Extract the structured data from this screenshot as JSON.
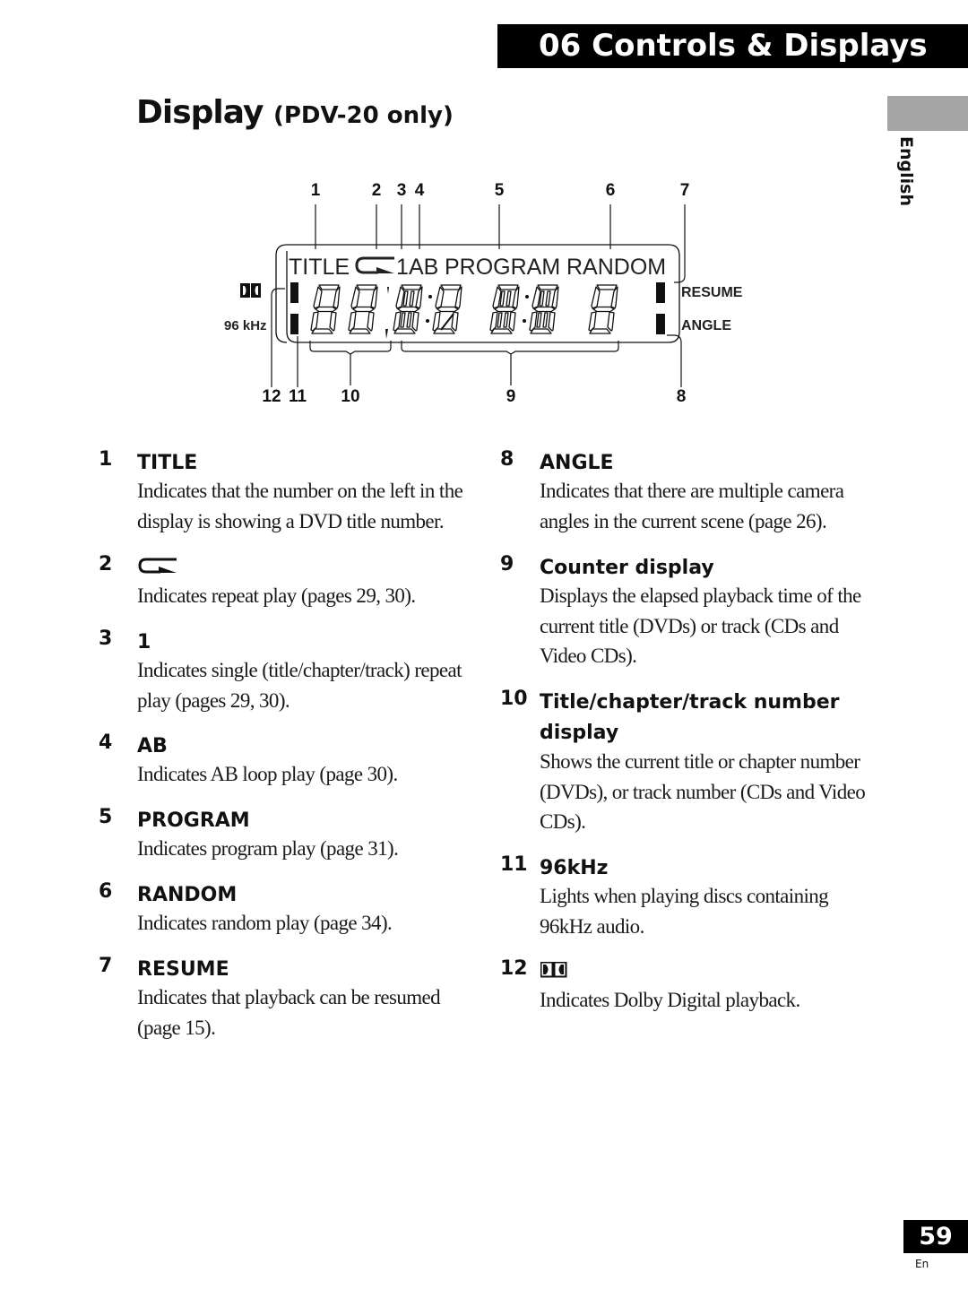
{
  "header": {
    "section_title": "06 Controls & Displays",
    "language_tab": "English"
  },
  "page": {
    "heading": "Display",
    "heading_sub": "(PDV-20 only)",
    "page_number": "59",
    "page_lang": "En"
  },
  "diagram": {
    "callouts_top": [
      "1",
      "2",
      "3",
      "4",
      "5",
      "6",
      "7"
    ],
    "callouts_bottom": [
      "12",
      "11",
      "10",
      "9",
      "8"
    ],
    "lcd": {
      "indicator_title": "TITLE",
      "indicator_one": "1",
      "indicator_ab": "AB",
      "indicator_program": "PROGRAM",
      "indicator_random": "RANDOM",
      "label_resume": "RESUME",
      "label_angle": "ANGLE",
      "label_96khz": "96 kHz",
      "repeat_icon": "repeat-arrow-icon",
      "dolby_icon": "dolby-digital-icon",
      "title_digits": "88",
      "counter_digits": "8:88:88"
    }
  },
  "items_left": [
    {
      "num": "1",
      "head": "TITLE",
      "icon": null,
      "body": [
        "Indicates that the number on the left in the",
        "display is showing a DVD title number."
      ]
    },
    {
      "num": "2",
      "head": "",
      "icon": "repeat-arrow-icon",
      "body": [
        "Indicates repeat play (pages 29, 30)."
      ]
    },
    {
      "num": "3",
      "head": "1",
      "icon": null,
      "body": [
        "Indicates single (title/chapter/track) repeat",
        "play (pages 29, 30)."
      ]
    },
    {
      "num": "4",
      "head": "AB",
      "icon": null,
      "body": [
        "Indicates AB loop play (page 30)."
      ]
    },
    {
      "num": "5",
      "head": "PROGRAM",
      "icon": null,
      "body": [
        "Indicates program play (page 31)."
      ]
    },
    {
      "num": "6",
      "head": "RANDOM",
      "icon": null,
      "body": [
        "Indicates random play (page 34)."
      ]
    },
    {
      "num": "7",
      "head": "RESUME",
      "icon": null,
      "body": [
        "Indicates that playback can be resumed",
        "(page 15)."
      ]
    }
  ],
  "items_right": [
    {
      "num": "8",
      "head": "ANGLE",
      "icon": null,
      "body": [
        "Indicates that there are multiple camera",
        "angles in the current scene (page 26)."
      ]
    },
    {
      "num": "9",
      "head": "Counter display",
      "icon": null,
      "body": [
        "Displays the elapsed playback time of the",
        "current title (DVDs) or track (CDs and",
        "Video CDs)."
      ]
    },
    {
      "num": "10",
      "head": "Title/chapter/track number",
      "head2": "display",
      "icon": null,
      "body": [
        "Shows the current title or chapter number",
        "(DVDs), or track number (CDs and Video",
        "CDs)."
      ]
    },
    {
      "num": "11",
      "head": "96kHz",
      "icon": null,
      "body": [
        "Lights when playing discs containing",
        "96kHz audio."
      ]
    },
    {
      "num": "12",
      "head": "",
      "icon": "dolby-digital-icon",
      "body": [
        "Indicates Dolby Digital playback."
      ]
    }
  ]
}
